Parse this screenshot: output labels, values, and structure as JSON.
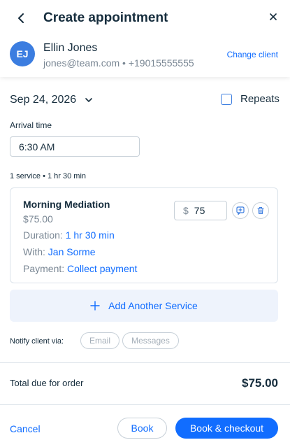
{
  "header": {
    "title": "Create appointment"
  },
  "client": {
    "initials": "EJ",
    "name": "Ellin Jones",
    "contact": "jones@team.com • +19015555555",
    "change_label": "Change client"
  },
  "schedule": {
    "date": "Sep 24, 2026",
    "repeats_label": "Repeats",
    "repeats_checked": false,
    "arrival_label": "Arrival time",
    "arrival_time": "6:30 AM"
  },
  "service_summary": "1 service • 1 hr 30 min",
  "service": {
    "name": "Morning Mediation",
    "price": "$75.00",
    "duration_label": "Duration:",
    "duration_value": "1 hr 30 min",
    "with_label": "With:",
    "with_value": "Jan Sorme",
    "payment_label": "Payment:",
    "payment_value": "Collect payment",
    "currency_symbol": "$",
    "price_input": "75"
  },
  "add_service_label": "Add Another Service",
  "notify": {
    "label": "Notify client via:",
    "options": [
      "Email",
      "Messages"
    ]
  },
  "total": {
    "label": "Total due for order",
    "value": "$75.00"
  },
  "footer": {
    "cancel_label": "Cancel",
    "book_label": "Book",
    "checkout_label": "Book & checkout"
  },
  "colors": {
    "accent": "#116dff",
    "avatar": "#3b7de0",
    "text": "#162d3d",
    "muted": "#7a8794"
  },
  "icons": {
    "back": "chevron-left-icon",
    "close": "close-icon",
    "date_dropdown": "chevron-down-icon",
    "add_note": "add-note-icon",
    "delete": "trash-icon",
    "add_service": "plus-icon"
  }
}
